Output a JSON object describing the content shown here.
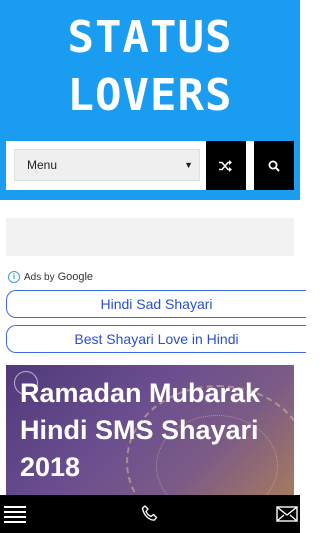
{
  "header": {
    "logo_line1": "STATUS",
    "logo_line2": "LOVERS",
    "background_color": "#1a9cf0"
  },
  "toolbar": {
    "menu_value": "Menu",
    "menu_arrow": "▼",
    "shuffle_icon": "shuffle-icon",
    "search_icon": "search-icon"
  },
  "ads": {
    "info_symbol": "i",
    "ads_by": "Ads by",
    "google": "Google"
  },
  "links": [
    {
      "label": "Hindi Sad Shayari"
    },
    {
      "label": "Best Shayari Love in Hindi"
    }
  ],
  "article": {
    "title": "Ramadan Mubarak Hindi SMS Shayari 2018"
  },
  "bottom_bar": {
    "menu_icon": "hamburger-icon",
    "phone_icon": "phone-icon",
    "mail_icon": "mail-icon"
  },
  "colors": {
    "link_border": "#3b68e6",
    "link_text": "#2a4fd6",
    "dark": "#000000"
  }
}
